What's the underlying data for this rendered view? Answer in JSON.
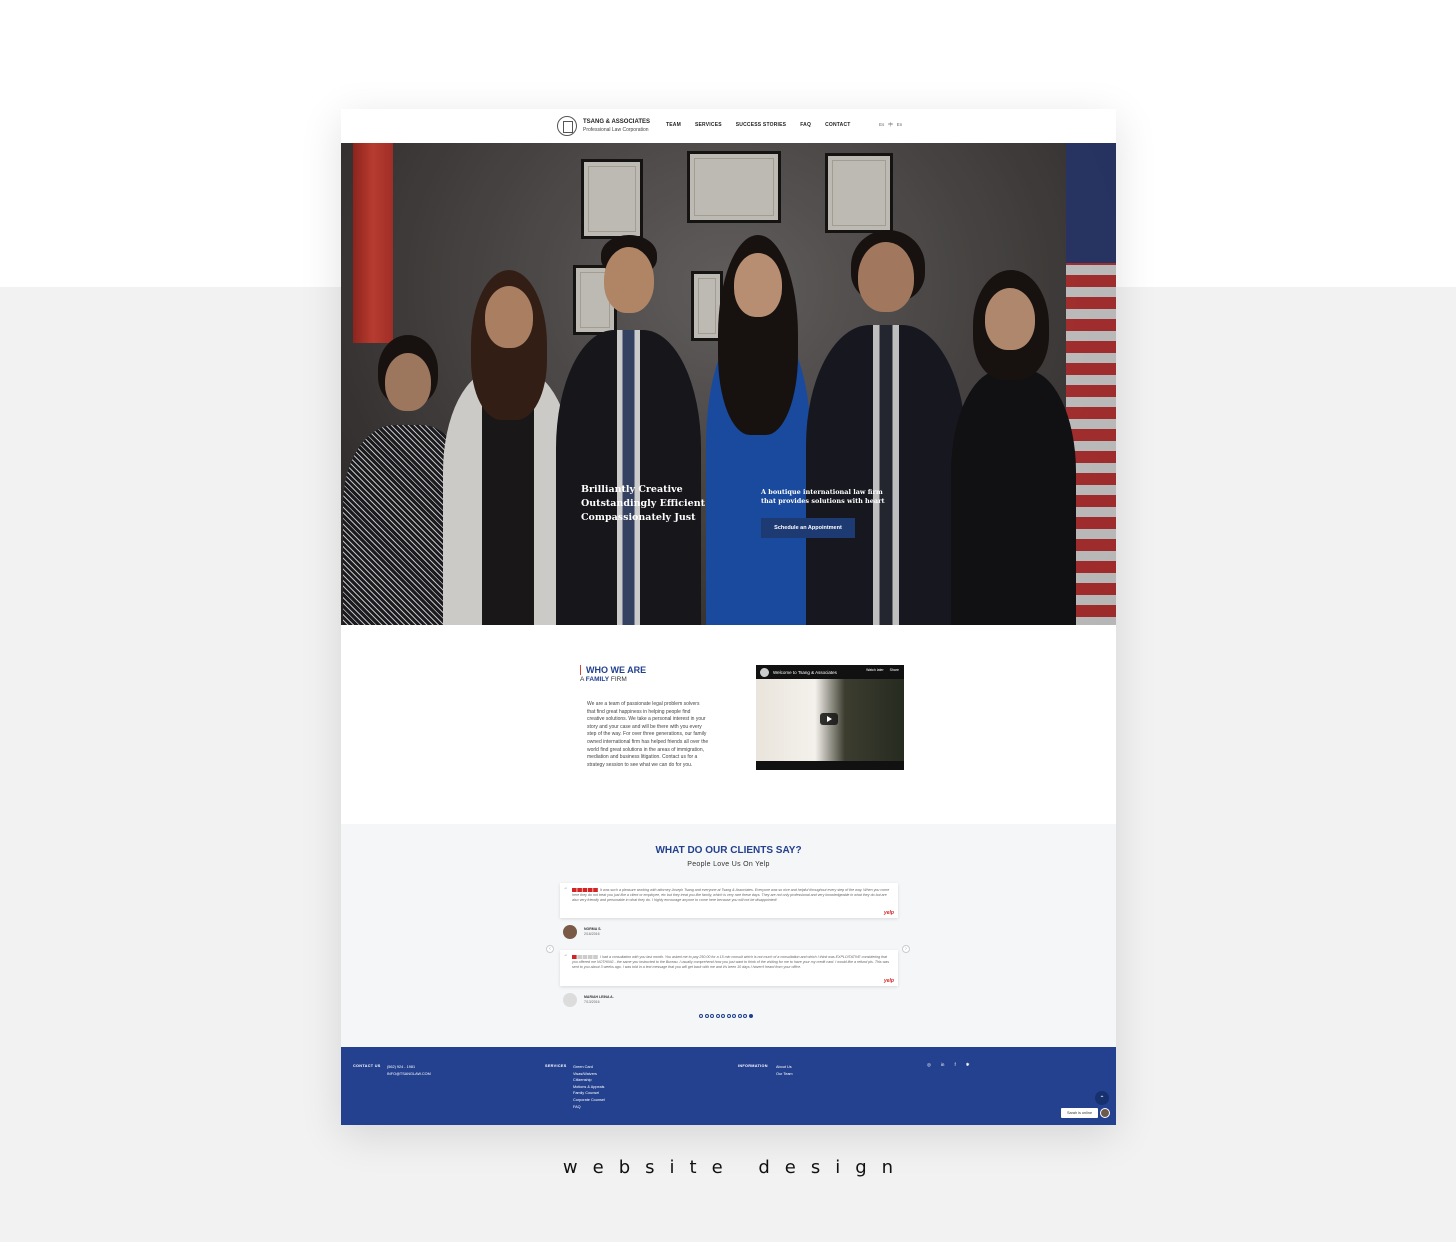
{
  "nav": {
    "logo_name": "TSANG & ASSOCIATES",
    "logo_sub": "Professional Law Corporation",
    "menu": [
      "TEAM",
      "SERVICES",
      "SUCCESS STORIES",
      "FAQ",
      "CONTACT"
    ],
    "langs": [
      "Es",
      "中",
      "En"
    ]
  },
  "hero": {
    "tagline_1": "Brilliantly Creative",
    "tagline_2": "Outstandingly Efficient",
    "tagline_3": "Compassionately Just",
    "right_text": "A boutique international law firm that provides solutions with heart",
    "cta": "Schedule an Appointment"
  },
  "who": {
    "title": "WHO WE ARE",
    "sub_prefix": "A",
    "sub_bold": "FAMILY",
    "sub_suffix": "FIRM",
    "text": "We are a team of passionate legal problem solvers that find great happiness in helping people find creative solutions. We take a personal interest in your story and your case and will be there with you every step of the way. For over three generations, our family owned international firm has helped friends all over the world find great solutions in the areas of immigration, mediation and business litigation. Contact us for a strategy session to see what we can do for you.",
    "video_title": "Welcome to Tsang & Associates",
    "video_watch_later": "Watch later",
    "video_share": "Share"
  },
  "clients": {
    "title": "WHAT DO OUR CLIENTS SAY?",
    "subtitle": "People Love Us On Yelp",
    "reviews": [
      {
        "text": "It was such a pleasure working with attorney Joseph Tsang and everyone at Tsang & Associates. Everyone was so nice and helpful throughout every step of the way. When you come here they do not treat you just like a client or employee, etc but they treat you like family, which is very rare these days. They are not only professional and very knowledgeable in what they do but are also very friendly and personable in what they do. I highly encourage anyone to come here because you will not be disappointed!",
        "name": "NORMA S.",
        "date": "2/16/2016",
        "rating": 5
      },
      {
        "text": "I had a consultation with you last month. You asked me to pay 250.00 for a 15 min consult which is not much of a consultation and which I think was EXPLOITATIVE considering that you offered me NOTHING - the same you instructed to the Bureau. I usually comprehend how you just want to think of the visiting for me to have your my credit card. I would like a refund pls. This was sent to you about 3 weeks ago. I was told in a text message that you will get back with me and it's been 10 days I haven't heard from your office.",
        "name": "MARIAH LEINA A.",
        "date": "7/13/2016",
        "rating": 1
      }
    ],
    "yelp": "yelp",
    "page_count": 10,
    "active_page": 10
  },
  "footer": {
    "contact_head": "CONTACT US",
    "phone": "(562) 924 - 1981",
    "email": "INFO@TSANGLAW.COM",
    "services_head": "SERVICES",
    "services": [
      "Green Card",
      "Visas/Waivers",
      "Citizenship",
      "Motions & Appeals",
      "Family Counsel",
      "Corporate Counsel",
      "FAQ"
    ],
    "info_head": "INFORMATION",
    "info": [
      "About Us",
      "Our Team"
    ],
    "social_icons": [
      "instagram-icon",
      "linkedin-icon",
      "facebook-icon",
      "yelp-icon"
    ],
    "chat_label": "Sarah is online"
  },
  "caption": "website design",
  "colors": {
    "brand_blue": "#23418f",
    "accent_red": "#d14437",
    "cta_blue": "#1d3a73"
  }
}
